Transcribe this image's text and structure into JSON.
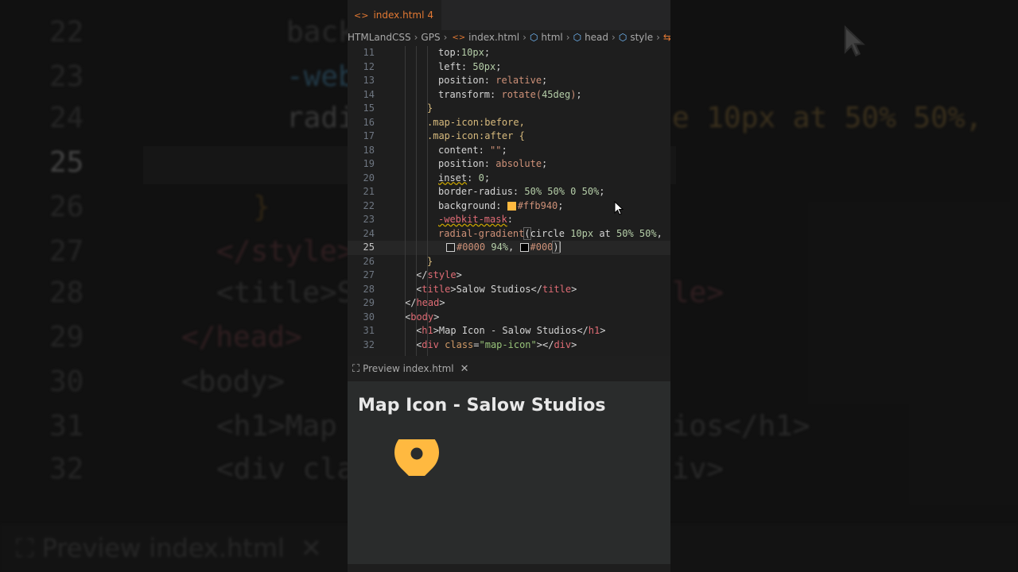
{
  "tab": {
    "filename": "index.html",
    "problems": "4"
  },
  "breadcrumb": [
    "HTMLandCSS",
    "GPS",
    "index.html",
    "html",
    "head",
    "style"
  ],
  "editor": {
    "lines": [
      {
        "n": "11",
        "text": "top:10px;"
      },
      {
        "n": "12",
        "text": "left: 50px;"
      },
      {
        "n": "13",
        "text": "position: relative;"
      },
      {
        "n": "14",
        "text": "transform: rotate(45deg);"
      },
      {
        "n": "15",
        "text": "}"
      },
      {
        "n": "16",
        "text": ".map-icon:before,"
      },
      {
        "n": "17",
        "text": ".map-icon:after {"
      },
      {
        "n": "18",
        "text": "content: \"\";"
      },
      {
        "n": "19",
        "text": "position: absolute;"
      },
      {
        "n": "20",
        "text": "inset: 0;"
      },
      {
        "n": "21",
        "text": "border-radius: 50% 50% 0 50%;"
      },
      {
        "n": "22",
        "text": "background: #ffb940;"
      },
      {
        "n": "23",
        "text": "-webkit-mask:"
      },
      {
        "n": "24",
        "text": "radial-gradient(circle 10px at 50% 50%,"
      },
      {
        "n": "25",
        "text": "#0000 94%, #000)"
      },
      {
        "n": "26",
        "text": "}"
      },
      {
        "n": "27",
        "text": "</style>"
      },
      {
        "n": "28",
        "text": "<title>Salow Studios</title>"
      },
      {
        "n": "29",
        "text": "</head>"
      },
      {
        "n": "30",
        "text": "<body>"
      },
      {
        "n": "31",
        "text": "<h1>Map Icon - Salow Studios</h1>"
      },
      {
        "n": "32",
        "text": "<div class=\"map-icon\"></div>"
      }
    ],
    "current_line": "25"
  },
  "preview_tab": {
    "label": "Preview index.html"
  },
  "preview": {
    "heading": "Map Icon - Salow Studios"
  },
  "background_zoom": {
    "line_numbers": [
      "22",
      "23",
      "24",
      "25",
      "26",
      "27",
      "28",
      "29",
      "30",
      "31",
      "32"
    ],
    "code": [
      "back",
      "-web",
      "radi",
      "",
      "}",
      "</style>",
      "<title>S",
      "</head>",
      "<body>",
      "<h1>Map",
      "<div cla"
    ],
    "right_code": [
      "",
      "",
      "e 10px at 50% 50%,",
      "",
      "",
      "",
      "le>",
      "",
      "",
      "ios</h1>",
      "iv>"
    ],
    "preview_label": "Preview index.html"
  },
  "colors": {
    "accent_orange": "#e37933",
    "pin_color": "#ffb940",
    "preview_bg": "#2a2c2c"
  },
  "icons": [
    "code-icon",
    "cube-icon",
    "preview-icon",
    "close-icon",
    "map-pin-icon",
    "mouse-cursor-icon"
  ]
}
